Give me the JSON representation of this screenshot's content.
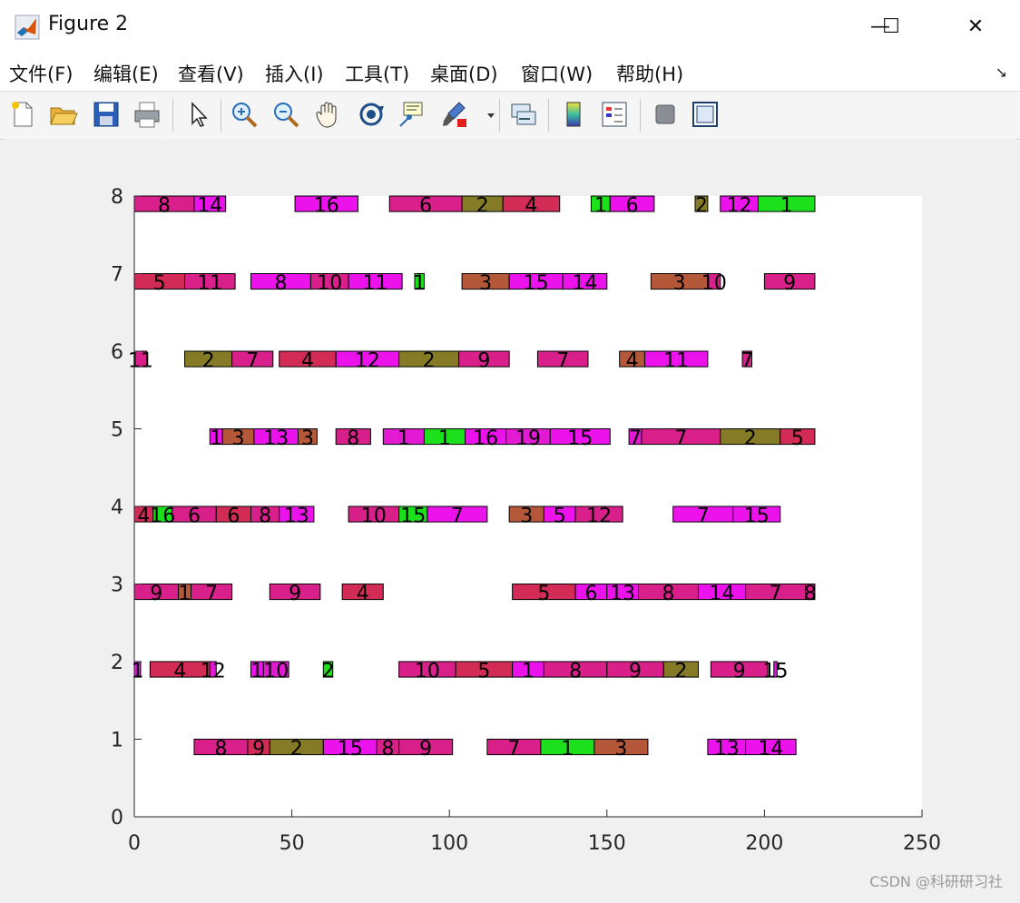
{
  "window": {
    "title": "Figure 2",
    "minimize_label": "—",
    "maximize_label": "☐",
    "close_label": "✕"
  },
  "menu": {
    "items": [
      "文件(F)",
      "编辑(E)",
      "查看(V)",
      "插入(I)",
      "工具(T)",
      "桌面(D)",
      "窗口(W)",
      "帮助(H)"
    ],
    "dock_label": "↘"
  },
  "toolbar": {
    "icons": [
      "new-figure-icon",
      "open-file-icon",
      "save-icon",
      "print-icon",
      "pointer-icon",
      "zoom-in-icon",
      "zoom-out-icon",
      "pan-hand-icon",
      "rotate-3d-icon",
      "data-cursor-icon",
      "brush-icon",
      "link-plot-icon",
      "colorbar-icon",
      "legend-icon",
      "hide-plot-tools-icon",
      "show-plot-tools-icon"
    ]
  },
  "watermark": "CSDN @科研研习社",
  "colors": {
    "magenta": "#e21ad3",
    "crimson": "#d22b55",
    "olive": "#857b26",
    "green": "#1de01d",
    "brown": "#b5583a",
    "pink": "#d9208a",
    "purple": "#ec12ec"
  },
  "chart_data": {
    "type": "gantt",
    "xlim": [
      0,
      250
    ],
    "ylim": [
      0,
      8
    ],
    "xticks": [
      0,
      50,
      100,
      150,
      200,
      250
    ],
    "yticks": [
      0,
      1,
      2,
      3,
      4,
      5,
      6,
      7,
      8
    ],
    "grid": false,
    "bar_height": 0.2,
    "label_offset": 0.1,
    "rows": [
      {
        "y": 1,
        "tasks": [
          {
            "start": 19,
            "end": 36,
            "label": "8",
            "color": "pink"
          },
          {
            "start": 36,
            "end": 43,
            "label": "9",
            "color": "crimson"
          },
          {
            "start": 43,
            "end": 60,
            "label": "2",
            "color": "olive"
          },
          {
            "start": 60,
            "end": 77,
            "label": "15",
            "color": "purple"
          },
          {
            "start": 77,
            "end": 84,
            "label": "8",
            "color": "pink"
          },
          {
            "start": 84,
            "end": 101,
            "label": "9",
            "color": "pink"
          },
          {
            "start": 112,
            "end": 129,
            "label": "7",
            "color": "pink"
          },
          {
            "start": 129,
            "end": 146,
            "label": "1",
            "color": "green"
          },
          {
            "start": 146,
            "end": 163,
            "label": "3",
            "color": "brown"
          },
          {
            "start": 182,
            "end": 194,
            "label": "13",
            "color": "purple"
          },
          {
            "start": 194,
            "end": 210,
            "label": "14",
            "color": "purple"
          }
        ]
      },
      {
        "y": 2,
        "tasks": [
          {
            "start": 0,
            "end": 2,
            "label": "1",
            "color": "purple"
          },
          {
            "start": 5,
            "end": 24,
            "label": "4",
            "color": "crimson"
          },
          {
            "start": 24,
            "end": 26,
            "label": "12",
            "color": "magenta"
          },
          {
            "start": 37,
            "end": 41,
            "label": "1",
            "color": "purple"
          },
          {
            "start": 41,
            "end": 49,
            "label": "10",
            "color": "magenta"
          },
          {
            "start": 60,
            "end": 63,
            "label": "2",
            "color": "green"
          },
          {
            "start": 84,
            "end": 102,
            "label": "10",
            "color": "pink"
          },
          {
            "start": 102,
            "end": 120,
            "label": "5",
            "color": "crimson"
          },
          {
            "start": 120,
            "end": 130,
            "label": "1",
            "color": "purple"
          },
          {
            "start": 130,
            "end": 150,
            "label": "8",
            "color": "pink"
          },
          {
            "start": 150,
            "end": 168,
            "label": "9",
            "color": "pink"
          },
          {
            "start": 168,
            "end": 179,
            "label": "2",
            "color": "olive"
          },
          {
            "start": 183,
            "end": 201,
            "label": "9",
            "color": "pink"
          },
          {
            "start": 203,
            "end": 204,
            "label": "15",
            "color": "purple"
          }
        ]
      },
      {
        "y": 3,
        "tasks": [
          {
            "start": 0,
            "end": 14,
            "label": "9",
            "color": "pink"
          },
          {
            "start": 14,
            "end": 18,
            "label": "1",
            "color": "brown"
          },
          {
            "start": 18,
            "end": 31,
            "label": "7",
            "color": "pink"
          },
          {
            "start": 43,
            "end": 59,
            "label": "9",
            "color": "pink"
          },
          {
            "start": 66,
            "end": 79,
            "label": "4",
            "color": "crimson"
          },
          {
            "start": 120,
            "end": 140,
            "label": "5",
            "color": "crimson"
          },
          {
            "start": 140,
            "end": 150,
            "label": "6",
            "color": "purple"
          },
          {
            "start": 150,
            "end": 160,
            "label": "13",
            "color": "purple"
          },
          {
            "start": 160,
            "end": 179,
            "label": "8",
            "color": "pink"
          },
          {
            "start": 179,
            "end": 194,
            "label": "14",
            "color": "purple"
          },
          {
            "start": 194,
            "end": 213,
            "label": "7",
            "color": "pink"
          },
          {
            "start": 213,
            "end": 216,
            "label": "8",
            "color": "pink"
          }
        ]
      },
      {
        "y": 4,
        "tasks": [
          {
            "start": 0,
            "end": 6,
            "label": "4",
            "color": "crimson"
          },
          {
            "start": 6,
            "end": 12,
            "label": "16",
            "color": "green"
          },
          {
            "start": 12,
            "end": 26,
            "label": "6",
            "color": "pink"
          },
          {
            "start": 26,
            "end": 37,
            "label": "6",
            "color": "crimson"
          },
          {
            "start": 37,
            "end": 46,
            "label": "8",
            "color": "pink"
          },
          {
            "start": 46,
            "end": 57,
            "label": "13",
            "color": "purple"
          },
          {
            "start": 68,
            "end": 84,
            "label": "10",
            "color": "pink"
          },
          {
            "start": 84,
            "end": 93,
            "label": "15",
            "color": "green"
          },
          {
            "start": 93,
            "end": 112,
            "label": "7",
            "color": "purple"
          },
          {
            "start": 119,
            "end": 130,
            "label": "3",
            "color": "brown"
          },
          {
            "start": 130,
            "end": 140,
            "label": "5",
            "color": "purple"
          },
          {
            "start": 140,
            "end": 155,
            "label": "12",
            "color": "pink"
          },
          {
            "start": 171,
            "end": 190,
            "label": "7",
            "color": "purple"
          },
          {
            "start": 190,
            "end": 205,
            "label": "15",
            "color": "purple"
          }
        ]
      },
      {
        "y": 5,
        "tasks": [
          {
            "start": 24,
            "end": 28,
            "label": "1",
            "color": "purple"
          },
          {
            "start": 28,
            "end": 38,
            "label": "3",
            "color": "brown"
          },
          {
            "start": 38,
            "end": 52,
            "label": "13",
            "color": "purple"
          },
          {
            "start": 52,
            "end": 58,
            "label": "3",
            "color": "brown"
          },
          {
            "start": 64,
            "end": 75,
            "label": "8",
            "color": "pink"
          },
          {
            "start": 79,
            "end": 92,
            "label": "1",
            "color": "magenta"
          },
          {
            "start": 92,
            "end": 105,
            "label": "1",
            "color": "green"
          },
          {
            "start": 105,
            "end": 118,
            "label": "16",
            "color": "purple"
          },
          {
            "start": 118,
            "end": 132,
            "label": "19",
            "color": "magenta"
          },
          {
            "start": 132,
            "end": 151,
            "label": "15",
            "color": "purple"
          },
          {
            "start": 157,
            "end": 161,
            "label": "7",
            "color": "magenta"
          },
          {
            "start": 161,
            "end": 186,
            "label": "7",
            "color": "pink"
          },
          {
            "start": 186,
            "end": 205,
            "label": "2",
            "color": "olive"
          },
          {
            "start": 205,
            "end": 216,
            "label": "5",
            "color": "crimson"
          }
        ]
      },
      {
        "y": 6,
        "tasks": [
          {
            "start": 0,
            "end": 4,
            "label": "11",
            "color": "pink"
          },
          {
            "start": 16,
            "end": 31,
            "label": "2",
            "color": "olive"
          },
          {
            "start": 31,
            "end": 44,
            "label": "7",
            "color": "pink"
          },
          {
            "start": 46,
            "end": 64,
            "label": "4",
            "color": "crimson"
          },
          {
            "start": 64,
            "end": 84,
            "label": "12",
            "color": "purple"
          },
          {
            "start": 84,
            "end": 103,
            "label": "2",
            "color": "olive"
          },
          {
            "start": 103,
            "end": 119,
            "label": "9",
            "color": "pink"
          },
          {
            "start": 128,
            "end": 144,
            "label": "7",
            "color": "pink"
          },
          {
            "start": 154,
            "end": 162,
            "label": "4",
            "color": "brown"
          },
          {
            "start": 162,
            "end": 182,
            "label": "11",
            "color": "purple"
          },
          {
            "start": 193,
            "end": 196,
            "label": "7",
            "color": "pink"
          }
        ]
      },
      {
        "y": 7,
        "tasks": [
          {
            "start": 0,
            "end": 16,
            "label": "5",
            "color": "crimson"
          },
          {
            "start": 16,
            "end": 32,
            "label": "11",
            "color": "pink"
          },
          {
            "start": 37,
            "end": 56,
            "label": "8",
            "color": "purple"
          },
          {
            "start": 56,
            "end": 68,
            "label": "10",
            "color": "pink"
          },
          {
            "start": 68,
            "end": 85,
            "label": "11",
            "color": "purple"
          },
          {
            "start": 89,
            "end": 92,
            "label": "1",
            "color": "green"
          },
          {
            "start": 104,
            "end": 119,
            "label": "3",
            "color": "brown"
          },
          {
            "start": 119,
            "end": 136,
            "label": "15",
            "color": "purple"
          },
          {
            "start": 136,
            "end": 150,
            "label": "14",
            "color": "purple"
          },
          {
            "start": 164,
            "end": 182,
            "label": "3",
            "color": "brown"
          },
          {
            "start": 182,
            "end": 186,
            "label": "10",
            "color": "pink"
          },
          {
            "start": 200,
            "end": 216,
            "label": "9",
            "color": "pink"
          }
        ]
      },
      {
        "y": 8,
        "tasks": [
          {
            "start": 0,
            "end": 19,
            "label": "8",
            "color": "pink"
          },
          {
            "start": 19,
            "end": 29,
            "label": "14",
            "color": "purple"
          },
          {
            "start": 51,
            "end": 71,
            "label": "16",
            "color": "purple"
          },
          {
            "start": 81,
            "end": 104,
            "label": "6",
            "color": "pink"
          },
          {
            "start": 104,
            "end": 117,
            "label": "2",
            "color": "olive"
          },
          {
            "start": 117,
            "end": 135,
            "label": "4",
            "color": "crimson"
          },
          {
            "start": 145,
            "end": 151,
            "label": "1",
            "color": "green"
          },
          {
            "start": 151,
            "end": 165,
            "label": "6",
            "color": "purple"
          },
          {
            "start": 178,
            "end": 182,
            "label": "2",
            "color": "olive"
          },
          {
            "start": 186,
            "end": 198,
            "label": "12",
            "color": "purple"
          },
          {
            "start": 198,
            "end": 216,
            "label": "1",
            "color": "green"
          }
        ]
      }
    ]
  }
}
